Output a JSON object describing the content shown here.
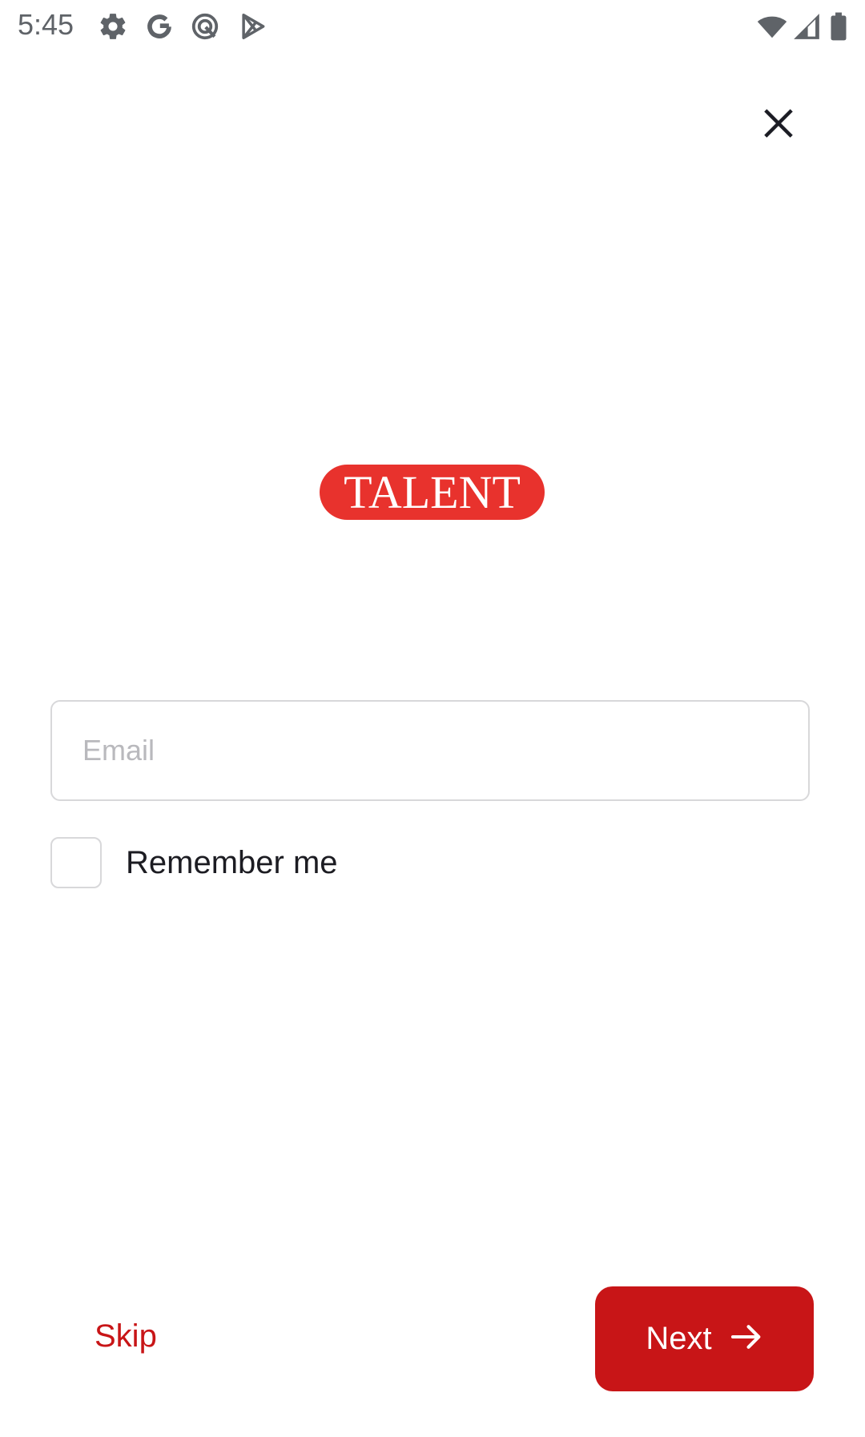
{
  "status_bar": {
    "time": "5:45",
    "left_icons": [
      "settings-gear-icon",
      "google-g-icon",
      "qualcomm-q-icon",
      "play-store-icon"
    ],
    "right_icons": [
      "wifi-icon",
      "cell-signal-icon",
      "battery-icon"
    ]
  },
  "header": {
    "close_icon": "close-icon"
  },
  "logo": {
    "text": "TALENT",
    "color": "#e8322d"
  },
  "form": {
    "email": {
      "value": "",
      "placeholder": "Email"
    },
    "remember_me": {
      "label": "Remember me",
      "checked": false
    }
  },
  "footer": {
    "skip_label": "Skip",
    "next_label": "Next",
    "next_icon": "arrow-right-icon",
    "accent_color": "#c81517"
  }
}
